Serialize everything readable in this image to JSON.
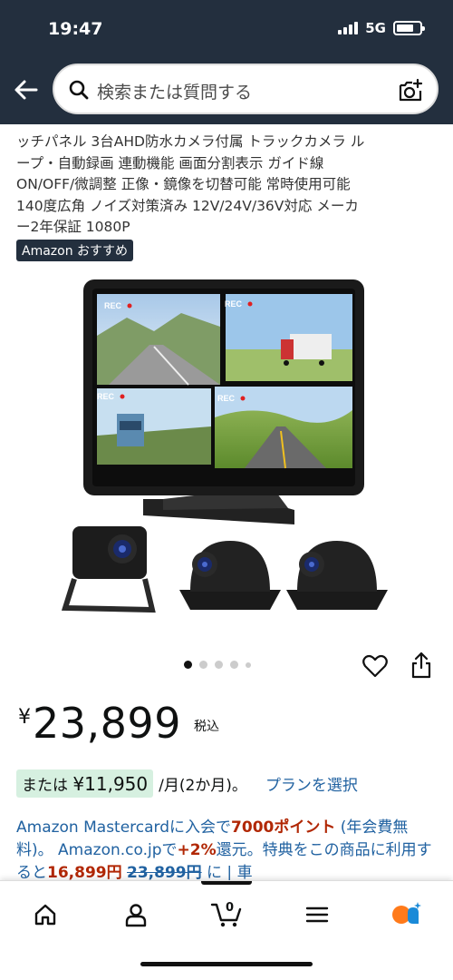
{
  "status": {
    "time": "19:47",
    "network": "5G"
  },
  "search": {
    "placeholder": "検索または質問する"
  },
  "product": {
    "title_line0": "",
    "title_lines": [
      "ッチパネル 3台AHD防水カメラ付属 トラックカメラ ル",
      "ープ・自動録画 連動機能 画面分割表示 ガイド線",
      "ON/OFF/微調整 正像・鏡像を切替可能 常時使用可能",
      "140度広角 ノイズ対策済み 12V/24V/36V対応 メーカ",
      "ー2年保証 1080P"
    ],
    "badge": "Amazon おすすめ",
    "image_rec_label": "REC",
    "image_count": 5,
    "image_index": 1
  },
  "price": {
    "currency": "¥",
    "value": "23,899",
    "tax": "税込"
  },
  "installment": {
    "prefix": "または",
    "amount": "¥11,950",
    "term": "/月(2か月)。",
    "plan_link": "プランを選択"
  },
  "promo": {
    "part1": "Amazon Mastercardに入会で",
    "points": "7000ポイント",
    "part2": " (年会費無料)。 Amazon.co.jpで",
    "rate": "+2%",
    "part3": "還元。特典をこの商品に利用すると",
    "discount_price": "16,899円",
    "part4": " ",
    "orig_price": "23,899円",
    "part5": " に | 車"
  },
  "tabs": [
    {
      "name": "home",
      "icon": "home-icon"
    },
    {
      "name": "account",
      "icon": "person-icon"
    },
    {
      "name": "cart",
      "icon": "cart-icon",
      "count": "0"
    },
    {
      "name": "menu",
      "icon": "menu-icon"
    },
    {
      "name": "rufus",
      "icon": "assistant-icon"
    }
  ],
  "colors": {
    "header": "#232f3e",
    "link": "#2162a1",
    "deal": "#b12704",
    "highlight": "#d6f0e0",
    "assistant": "#ff7a1a"
  }
}
